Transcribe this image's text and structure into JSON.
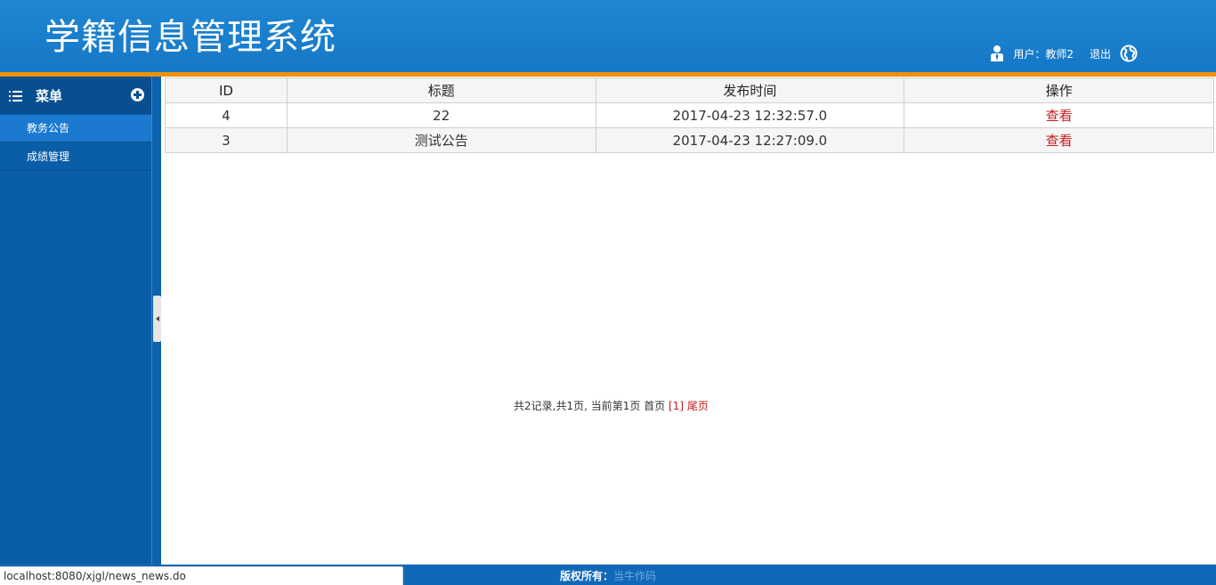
{
  "header": {
    "app_title": "学籍信息管理系统",
    "user_label": "用户：教师2",
    "logout_label": "退出"
  },
  "sidebar": {
    "menu_title": "菜单",
    "items": [
      {
        "label": "教务公告",
        "active": true
      },
      {
        "label": "成绩管理",
        "active": false
      }
    ]
  },
  "table": {
    "columns": [
      "ID",
      "标题",
      "发布时间",
      "操作"
    ],
    "rows": [
      {
        "id": "4",
        "title": "22",
        "time": "2017-04-23 12:32:57.0",
        "action": "查看"
      },
      {
        "id": "3",
        "title": "测试公告",
        "time": "2017-04-23 12:27:09.0",
        "action": "查看"
      }
    ]
  },
  "pager": {
    "summary": "共2记录,共1页, 当前第1页",
    "first": "首页",
    "current": "[1]",
    "last": "尾页"
  },
  "footer": {
    "copyright_label": "版权所有：",
    "author": "当牛作码"
  },
  "status_bar": {
    "url": "localhost:8080/xjgl/news_news.do"
  },
  "colors": {
    "header_blue": "#1578c7",
    "accent_orange": "#f0900b",
    "sidebar_blue": "#0a5ea8",
    "link_red": "#c41b1b"
  },
  "icons": {
    "user": "user-icon",
    "globe": "globe-icon",
    "menu": "list-icon",
    "add": "plus-circle-icon",
    "collapse": "collapse-arrow-icon"
  }
}
